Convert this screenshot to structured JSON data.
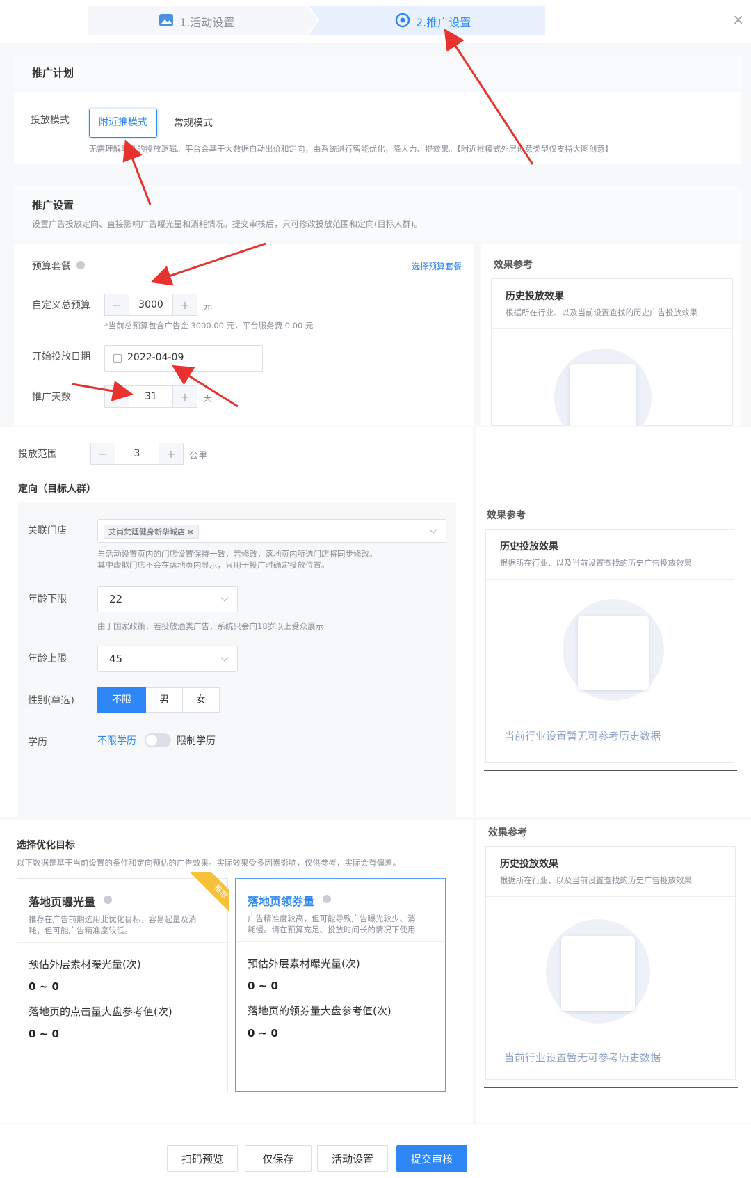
{
  "steps": [
    {
      "label": "1.活动设置"
    },
    {
      "label": "2.推广设置"
    }
  ],
  "close_icon": "close-icon",
  "plan": {
    "title": "推广计划",
    "mode_label": "投放模式",
    "modes": [
      "附近推模式",
      "常规模式"
    ],
    "selected_mode": "附近推模式",
    "mode_hint": "无需理解复杂的投放逻辑。平台会基于大数据自动出价和定向，由系统进行智能优化，降人力、提效果。【附近推模式外层创意类型仅支持大图创意】"
  },
  "settings": {
    "title": "推广设置",
    "desc": "设置广告投放定向、直接影响广告曝光量和消耗情况。提交审核后，只可修改投放范围和定向(目标人群)。",
    "budget_label": "预算套餐",
    "budget_link": "选择预算套餐",
    "custom_budget_label": "自定义总预算",
    "custom_budget_value": "3000",
    "custom_budget_unit": "元",
    "budget_note": "*当前总预算包含广告金 3000.00 元，平台服务费 0.00 元",
    "start_date_label": "开始投放日期",
    "start_date_value": "2022-04-09",
    "days_label": "推广天数",
    "days_value": "31",
    "days_unit": "天",
    "range_label": "投放范围",
    "range_value": "3",
    "range_unit": "公里"
  },
  "targeting": {
    "title": "定向（目标人群）",
    "store_label": "关联门店",
    "store_tag": "艾尚梵廷健身新华城店",
    "store_hint_1": "与活动设置页内的门店设置保持一致，若修改，落地页内所选门店将同步修改。",
    "store_hint_2": "其中虚拟门店不会在落地页内显示，只用于投广时确定投放位置。",
    "age_min_label": "年龄下限",
    "age_min_value": "22",
    "age_hint": "由于国家政策，若投放酒类广告，系统只会向18岁以上受众展示",
    "age_max_label": "年龄上限",
    "age_max_value": "45",
    "gender_label": "性别(单选)",
    "genders": [
      "不限",
      "男",
      "女"
    ],
    "selected_gender": "不限",
    "edu_label": "学历",
    "edu_off": "不限学历",
    "edu_on": "限制学历"
  },
  "effect": {
    "title": "效果参考",
    "card_title": "历史投放效果",
    "card_desc": "根据所在行业、以及当前设置查找的历史广告投放效果",
    "empty_text": "当前行业设置暂无可参考历史数据"
  },
  "optimize": {
    "title": "选择优化目标",
    "desc": "以下数据是基于当前设置的条件和定向预估的广告效果。实际效果受多因素影响，仅供参考，实际会有偏差。",
    "recommend_badge": "推荐",
    "cards": [
      {
        "title": "落地页曝光量",
        "desc_1": "推荐在广告前期选用此优化目标，容易起量及消",
        "desc_2": "耗，但可能广告精准度较低。",
        "m1_label": "预估外层素材曝光量(次)",
        "m1_value": "0 ~ 0",
        "m2_label": "落地页的点击量大盘参考值(次)",
        "m2_value": "0 ~ 0"
      },
      {
        "title": "落地页领券量",
        "desc_1": "广告精准度较高，但可能导致广告曝光较少、消",
        "desc_2": "耗慢。请在预算充足、投放时间长的情况下使用",
        "m1_label": "预估外层素材曝光量(次)",
        "m1_value": "0 ~ 0",
        "m2_label": "落地页的领券量大盘参考值(次)",
        "m2_value": "0 ~ 0"
      }
    ]
  },
  "footer": {
    "buttons": [
      "扫码预览",
      "仅保存",
      "活动设置",
      "提交审核"
    ]
  },
  "colors": {
    "primary": "#2f86f6",
    "annotation_arrow": "#e8322d",
    "badge": "#f8c13a"
  }
}
